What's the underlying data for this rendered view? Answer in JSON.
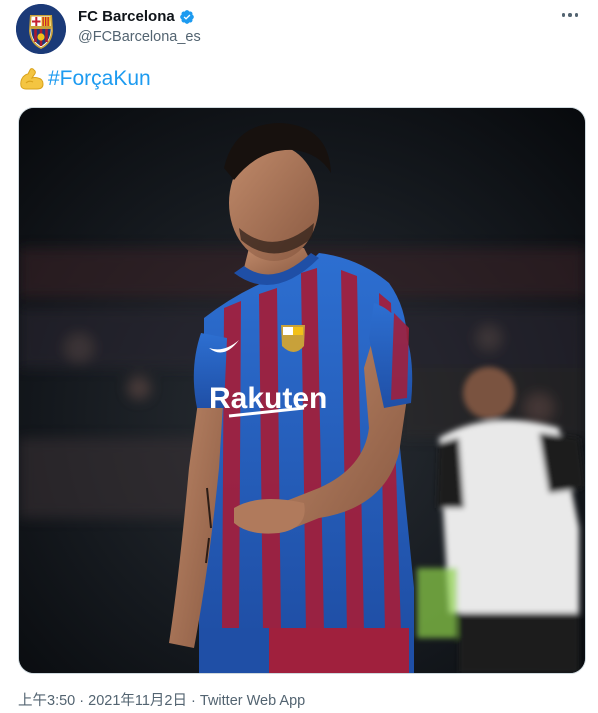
{
  "account": {
    "name": "FC Barcelona",
    "handle": "@FCBarcelona_es",
    "avatar_icon": "fc-barcelona-crest-icon",
    "verified_icon": "verified-badge-icon"
  },
  "more_icon": "more-options-icon",
  "tweet": {
    "emoji_icon": "flexed-biceps-icon",
    "hashtag": "#ForçaKun"
  },
  "media": {
    "photo_icon": "player-photo-image",
    "jersey_sponsor": "Rakuten"
  },
  "meta": {
    "time": "上午3:50",
    "separator1": " · ",
    "date": "2021年11月2日",
    "separator2": " · ",
    "app": "Twitter Web App"
  },
  "colors": {
    "link": "#1d9bf0",
    "secondary_text": "#536471",
    "primary_text": "#0f1419"
  }
}
